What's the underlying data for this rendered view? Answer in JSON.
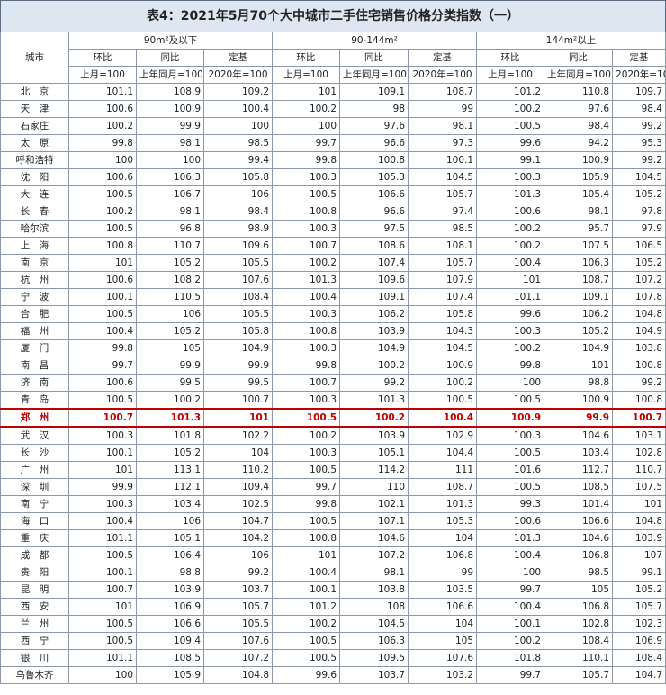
{
  "title": "表4：2021年5月70个大中城市二手住宅销售价格分类指数（一）",
  "header": {
    "city": "城市",
    "groups": [
      "90m²及以下",
      "90-144m²",
      "144m²以上"
    ],
    "metrics": [
      "环比",
      "同比",
      "定基"
    ],
    "bases": [
      "上月=100",
      "上年同月=100",
      "2020年=100"
    ]
  },
  "highlight_city": "郑州",
  "highlight_color": "#c00000",
  "rows": [
    {
      "city": "北　京",
      "v": [
        "101.1",
        "108.9",
        "109.2",
        "101",
        "109.1",
        "108.7",
        "101.2",
        "110.8",
        "109.7"
      ]
    },
    {
      "city": "天　津",
      "v": [
        "100.6",
        "100.9",
        "100.4",
        "100.2",
        "98",
        "99",
        "100.2",
        "97.6",
        "98.4"
      ]
    },
    {
      "city": "石家庄",
      "v": [
        "100.2",
        "99.9",
        "100",
        "100",
        "97.6",
        "98.1",
        "100.5",
        "98.4",
        "99.2"
      ]
    },
    {
      "city": "太　原",
      "v": [
        "99.8",
        "98.1",
        "98.5",
        "99.7",
        "96.6",
        "97.3",
        "99.6",
        "94.2",
        "95.3"
      ]
    },
    {
      "city": "呼和浩特",
      "v": [
        "100",
        "100",
        "99.4",
        "99.8",
        "100.8",
        "100.1",
        "99.1",
        "100.9",
        "99.2"
      ]
    },
    {
      "city": "沈　阳",
      "v": [
        "100.6",
        "106.3",
        "105.8",
        "100.3",
        "105.3",
        "104.5",
        "100.3",
        "105.9",
        "104.5"
      ]
    },
    {
      "city": "大　连",
      "v": [
        "100.5",
        "106.7",
        "106",
        "100.5",
        "106.6",
        "105.7",
        "101.3",
        "105.4",
        "105.2"
      ]
    },
    {
      "city": "长　春",
      "v": [
        "100.2",
        "98.1",
        "98.4",
        "100.8",
        "96.6",
        "97.4",
        "100.6",
        "98.1",
        "97.8"
      ]
    },
    {
      "city": "哈尔滨",
      "v": [
        "100.5",
        "96.8",
        "98.9",
        "100.3",
        "97.5",
        "98.5",
        "100.2",
        "95.7",
        "97.9"
      ]
    },
    {
      "city": "上　海",
      "v": [
        "100.8",
        "110.7",
        "109.6",
        "100.7",
        "108.6",
        "108.1",
        "100.2",
        "107.5",
        "106.5"
      ]
    },
    {
      "city": "南　京",
      "v": [
        "101",
        "105.2",
        "105.5",
        "100.2",
        "107.4",
        "105.7",
        "100.4",
        "106.3",
        "105.2"
      ]
    },
    {
      "city": "杭　州",
      "v": [
        "100.6",
        "108.2",
        "107.6",
        "101.3",
        "109.6",
        "107.9",
        "101",
        "108.7",
        "107.2"
      ]
    },
    {
      "city": "宁　波",
      "v": [
        "100.1",
        "110.5",
        "108.4",
        "100.4",
        "109.1",
        "107.4",
        "101.1",
        "109.1",
        "107.8"
      ]
    },
    {
      "city": "合　肥",
      "v": [
        "100.5",
        "106",
        "105.5",
        "100.3",
        "106.2",
        "105.8",
        "99.6",
        "106.2",
        "104.8"
      ]
    },
    {
      "city": "福　州",
      "v": [
        "100.4",
        "105.2",
        "105.8",
        "100.8",
        "103.9",
        "104.3",
        "100.3",
        "105.2",
        "104.9"
      ]
    },
    {
      "city": "厦　门",
      "v": [
        "99.8",
        "105",
        "104.9",
        "100.3",
        "104.9",
        "104.5",
        "100.2",
        "104.9",
        "103.8"
      ]
    },
    {
      "city": "南　昌",
      "v": [
        "99.7",
        "99.9",
        "99.9",
        "99.8",
        "100.2",
        "100.9",
        "99.8",
        "101",
        "100.8"
      ]
    },
    {
      "city": "济　南",
      "v": [
        "100.6",
        "99.5",
        "99.5",
        "100.7",
        "99.2",
        "100.2",
        "100",
        "98.8",
        "99.2"
      ]
    },
    {
      "city": "青　岛",
      "v": [
        "100.5",
        "100.2",
        "100.7",
        "100.3",
        "101.3",
        "100.5",
        "100.5",
        "100.9",
        "100.8"
      ]
    },
    {
      "city": "郑　州",
      "v": [
        "100.7",
        "101.3",
        "101",
        "100.5",
        "100.2",
        "100.4",
        "100.9",
        "99.9",
        "100.7"
      ]
    },
    {
      "city": "武　汉",
      "v": [
        "100.3",
        "101.8",
        "102.2",
        "100.2",
        "103.9",
        "102.9",
        "100.3",
        "104.6",
        "103.1"
      ]
    },
    {
      "city": "长　沙",
      "v": [
        "100.1",
        "105.2",
        "104",
        "100.3",
        "105.1",
        "104.4",
        "100.5",
        "103.4",
        "102.8"
      ]
    },
    {
      "city": "广　州",
      "v": [
        "101",
        "113.1",
        "110.2",
        "100.5",
        "114.2",
        "111",
        "101.6",
        "112.7",
        "110.7"
      ]
    },
    {
      "city": "深　圳",
      "v": [
        "99.9",
        "112.1",
        "109.4",
        "99.7",
        "110",
        "108.7",
        "100.5",
        "108.5",
        "107.5"
      ]
    },
    {
      "city": "南　宁",
      "v": [
        "100.3",
        "103.4",
        "102.5",
        "99.8",
        "102.1",
        "101.3",
        "99.3",
        "101.4",
        "101"
      ]
    },
    {
      "city": "海　口",
      "v": [
        "100.4",
        "106",
        "104.7",
        "100.5",
        "107.1",
        "105.3",
        "100.6",
        "106.6",
        "104.8"
      ]
    },
    {
      "city": "重　庆",
      "v": [
        "101.1",
        "105.1",
        "104.2",
        "100.8",
        "104.6",
        "104",
        "101.3",
        "104.6",
        "103.9"
      ]
    },
    {
      "city": "成　都",
      "v": [
        "100.5",
        "106.4",
        "106",
        "101",
        "107.2",
        "106.8",
        "100.4",
        "106.8",
        "107"
      ]
    },
    {
      "city": "贵　阳",
      "v": [
        "100.1",
        "98.8",
        "99.2",
        "100.4",
        "98.1",
        "99",
        "100",
        "98.5",
        "99.1"
      ]
    },
    {
      "city": "昆　明",
      "v": [
        "100.7",
        "103.9",
        "103.7",
        "100.1",
        "103.8",
        "103.5",
        "99.7",
        "105",
        "105.2"
      ]
    },
    {
      "city": "西　安",
      "v": [
        "101",
        "106.9",
        "105.7",
        "101.2",
        "108",
        "106.6",
        "100.4",
        "106.8",
        "105.7"
      ]
    },
    {
      "city": "兰　州",
      "v": [
        "100.5",
        "106.6",
        "105.5",
        "100.2",
        "104.5",
        "104",
        "100.1",
        "102.8",
        "102.3"
      ]
    },
    {
      "city": "西　宁",
      "v": [
        "100.5",
        "109.4",
        "107.6",
        "100.5",
        "106.3",
        "105",
        "100.2",
        "108.4",
        "106.9"
      ]
    },
    {
      "city": "银　川",
      "v": [
        "101.1",
        "108.5",
        "107.2",
        "100.5",
        "109.5",
        "107.6",
        "101.8",
        "110.1",
        "108.4"
      ]
    },
    {
      "city": "乌鲁木齐",
      "v": [
        "100",
        "105.9",
        "104.8",
        "99.6",
        "103.7",
        "103.2",
        "99.7",
        "105.7",
        "104.7"
      ]
    }
  ]
}
